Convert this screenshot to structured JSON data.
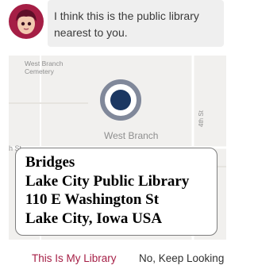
{
  "message": {
    "avatar_icon": "libby-owl-avatar-icon",
    "text": "I think this is the public library nearest to you."
  },
  "map": {
    "cemetery_label": "West Branch Cemetery",
    "town_label": "West Branch",
    "street_label": "4th St",
    "street_label_left": "h St",
    "pin_icon": "location-pin-icon"
  },
  "library": {
    "name": "Bridges",
    "library_name": "Lake City Public Library",
    "street": "110 E Washington St",
    "city": "Lake City, Iowa USA"
  },
  "actions": {
    "confirm_label": "This Is My Library",
    "decline_label": "No, Keep Looking"
  },
  "colors": {
    "brand": "#a51e45",
    "pin": "#1b3762",
    "pin_ring": "#80889a",
    "bubble": "#efefef",
    "map": "#f1f0ee"
  }
}
